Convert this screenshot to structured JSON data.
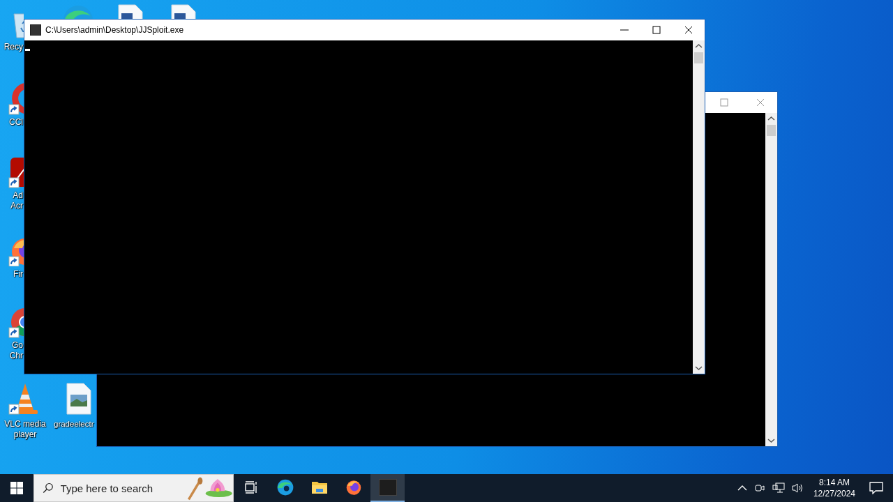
{
  "desktop_icons": [
    {
      "kind": "recycle-bin",
      "shortcut": false,
      "lines": [
        "Recy"
      ]
    },
    {
      "kind": "ccleaner",
      "shortcut": true,
      "lines": [
        "CCl"
      ]
    },
    {
      "kind": "acrobat",
      "shortcut": true,
      "lines": [
        "Ad",
        "Acr"
      ]
    },
    {
      "kind": "firefox",
      "shortcut": true,
      "lines": [
        "Fir"
      ]
    },
    {
      "kind": "chrome",
      "shortcut": true,
      "lines": [
        "Go",
        "Chr"
      ]
    },
    {
      "kind": "vlc",
      "shortcut": true,
      "lines": [
        "VLC media",
        "player"
      ]
    },
    {
      "kind": "image-file",
      "shortcut": false,
      "lines": [
        "gradeelectr"
      ]
    },
    {
      "kind": "edge"
    },
    {
      "kind": "document"
    },
    {
      "kind": "document"
    }
  ],
  "console_window": {
    "title": "C:\\Users\\admin\\Desktop\\JJSploit.exe"
  },
  "taskbar": {
    "search": {
      "placeholder": "Type here to search"
    },
    "apps": [
      {
        "kind": "task-view",
        "selected": false
      },
      {
        "kind": "edge",
        "selected": false
      },
      {
        "kind": "folder",
        "selected": false
      },
      {
        "kind": "firefox",
        "selected": false
      },
      {
        "kind": "console",
        "selected": true
      }
    ],
    "clock": {
      "time": "8:14 AM",
      "date": "12/27/2024"
    }
  }
}
